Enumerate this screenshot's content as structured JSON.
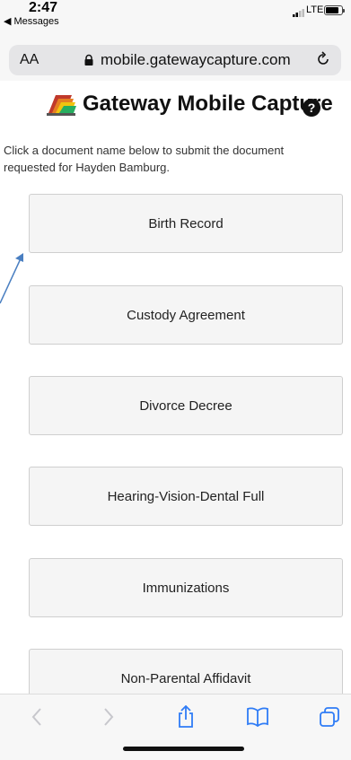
{
  "status_bar": {
    "time": "2:47",
    "back_app": "◀ Messages",
    "network": "LTE"
  },
  "address_bar": {
    "text_size_label": "AA",
    "url": "mobile.gatewaycapture.com"
  },
  "header": {
    "title": "Gateway Mobile Capture"
  },
  "instructions": "Click a document name below to submit the document requested for Hayden Bamburg.",
  "documents": [
    "Birth Record",
    "Custody Agreement",
    "Divorce Decree",
    "Hearing-Vision-Dental Full",
    "Immunizations",
    "Non-Parental Affidavit"
  ],
  "toolbar": {
    "icons": [
      "back-icon",
      "forward-icon",
      "share-icon",
      "bookmarks-icon",
      "tabs-icon"
    ]
  },
  "colors": {
    "button_bg": "#f5f5f5",
    "button_border": "#cfcfcf",
    "accent_arrow": "#4a7fc1"
  }
}
